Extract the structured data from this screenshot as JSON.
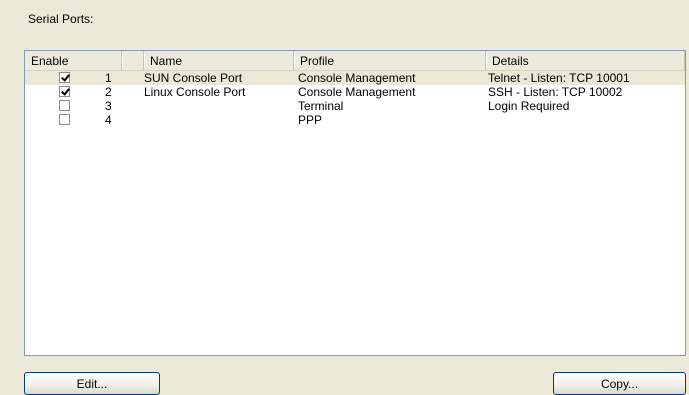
{
  "section_label": "Serial Ports:",
  "columns": {
    "enable": "Enable",
    "num": "",
    "name": "Name",
    "profile": "Profile",
    "details": "Details"
  },
  "rows": [
    {
      "enabled": true,
      "num": "1",
      "name": "SUN Console Port",
      "profile": "Console Management",
      "details": "Telnet - Listen: TCP 10001"
    },
    {
      "enabled": true,
      "num": "2",
      "name": "Linux Console Port",
      "profile": "Console Management",
      "details": "SSH - Listen: TCP 10002"
    },
    {
      "enabled": false,
      "num": "3",
      "name": "",
      "profile": "Terminal",
      "details": "Login Required"
    },
    {
      "enabled": false,
      "num": "4",
      "name": "",
      "profile": "PPP",
      "details": ""
    }
  ],
  "buttons": {
    "edit": "Edit...",
    "copy": "Copy..."
  }
}
